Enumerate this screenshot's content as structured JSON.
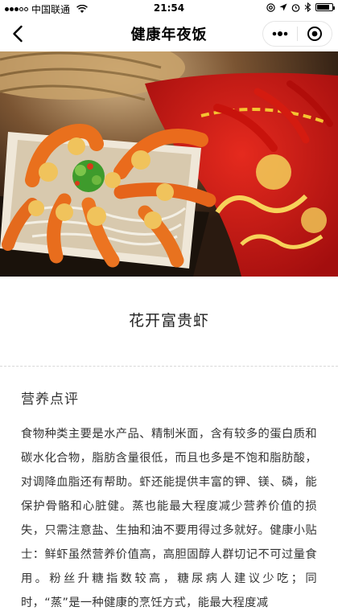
{
  "status_bar": {
    "carrier": "中国联通",
    "time": "21:54",
    "battery_level": 0.85
  },
  "nav": {
    "title": "健康年夜饭"
  },
  "dish": {
    "name": "花开富贵虾"
  },
  "nutrition": {
    "heading": "营养点评",
    "text": "食物种类主要是水产品、精制米面，含有较多的蛋白质和碳水化合物，脂肪含量很低，而且也多是不饱和脂肪酸，对调降血脂还有帮助。虾还能提供丰富的钾、镁、磷，能保护骨骼和心脏健。蒸也能最大程度减少营养价值的损失，只需注意盐、生抽和油不要用得过多就好。健康小贴士：鲜虾虽然营养价值高，高胆固醇人群切记不可过量食用。粉丝升糖指数较高，糖尿病人建议少吃；同时，“蒸”是一种健康的烹饪方式，能最大程度减"
  },
  "icons": {
    "back": "chevron-left-icon",
    "more": "more-dots-icon",
    "close": "capsule-close-icon",
    "wifi": "wifi-icon"
  },
  "colors": {
    "nav_bg": "#ffffff",
    "text": "#222222",
    "divider": "#d8d8d8"
  }
}
